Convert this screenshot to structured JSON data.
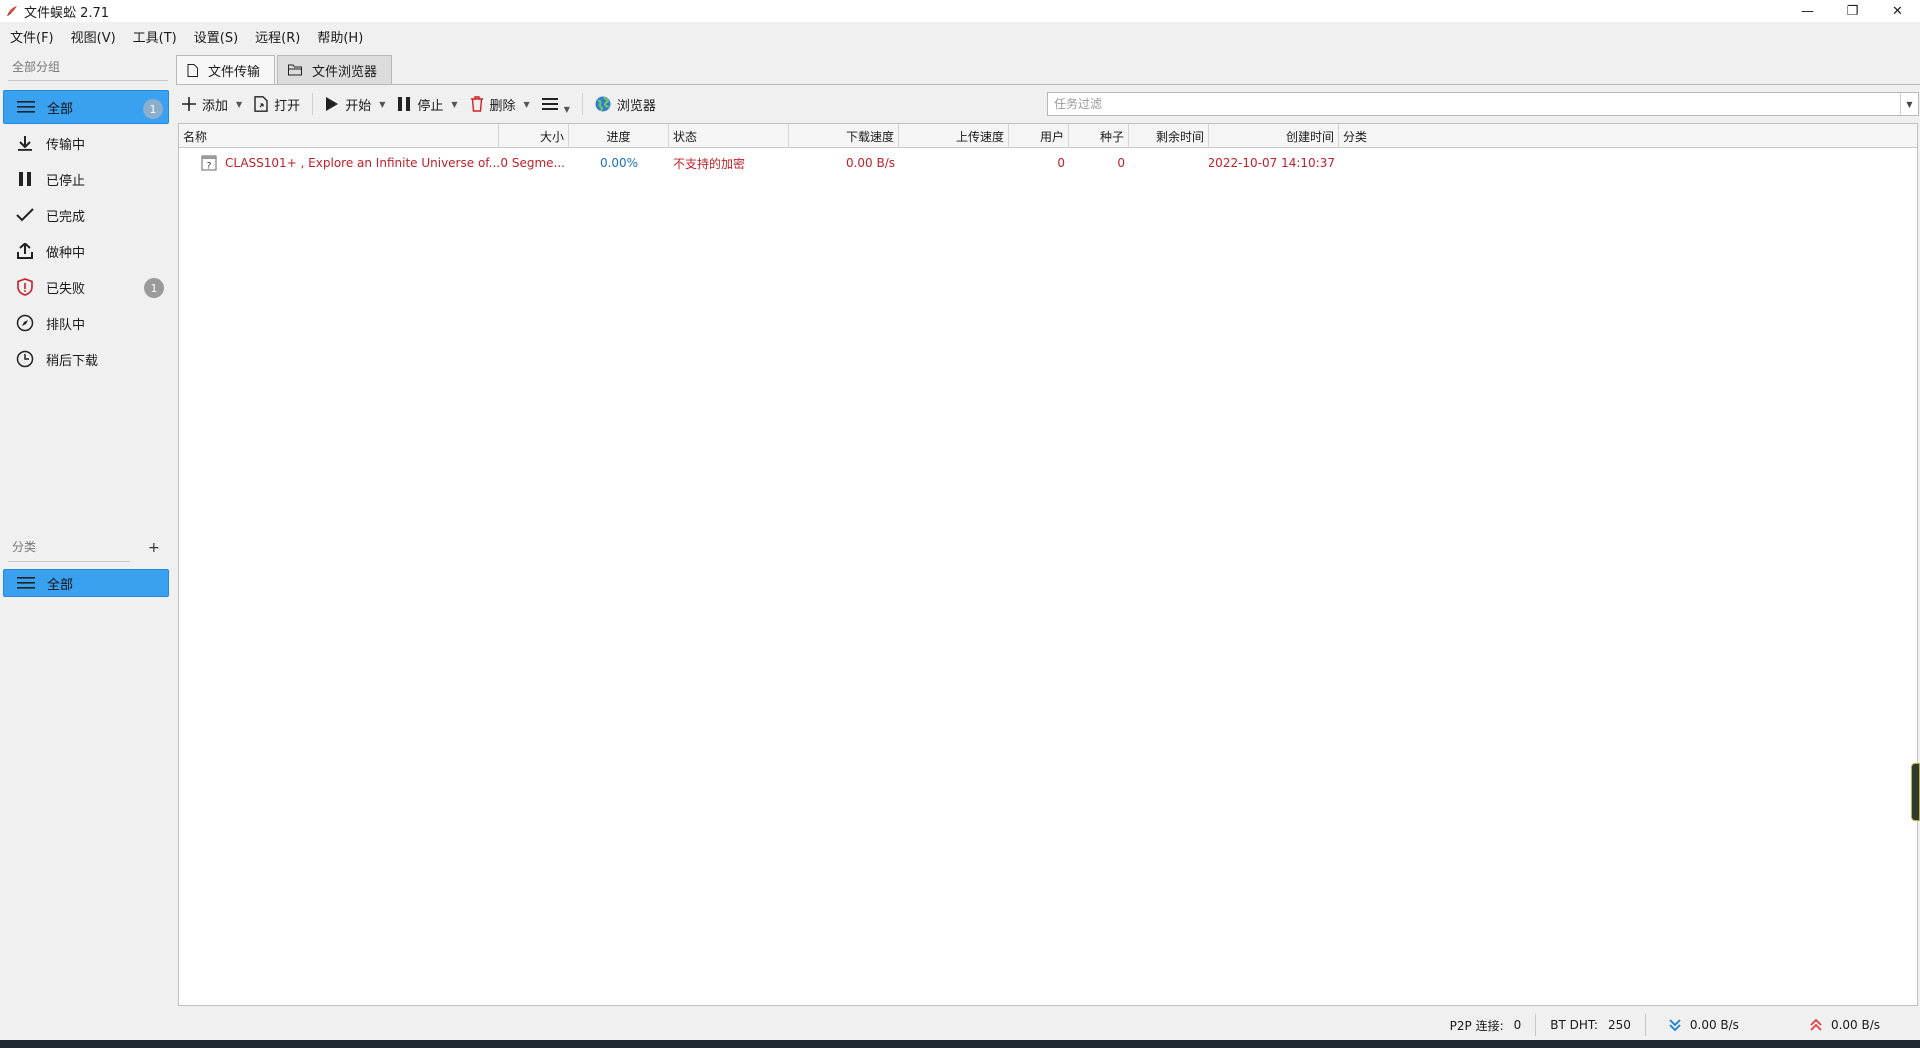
{
  "window": {
    "title": "文件蜈蚣 2.71",
    "controls": {
      "minimize": "—",
      "restore": "❐",
      "close": "✕"
    }
  },
  "menubar": {
    "items": [
      "文件(F)",
      "视图(V)",
      "工具(T)",
      "设置(S)",
      "远程(R)",
      "帮助(H)"
    ]
  },
  "sidebar": {
    "groups_label": "全部分组",
    "items": [
      {
        "label": "全部",
        "icon": "list-icon",
        "count": "1",
        "active": true
      },
      {
        "label": "传输中",
        "icon": "download-icon"
      },
      {
        "label": "已停止",
        "icon": "pause-icon"
      },
      {
        "label": "已完成",
        "icon": "check-icon"
      },
      {
        "label": "做种中",
        "icon": "upload-icon"
      },
      {
        "label": "已失败",
        "icon": "shield-alert-icon",
        "count": "1"
      },
      {
        "label": "排队中",
        "icon": "compass-icon"
      },
      {
        "label": "稍后下载",
        "icon": "clock-icon"
      }
    ],
    "categories_label": "分类",
    "add_label": "+",
    "categories": [
      {
        "label": "全部",
        "icon": "list-icon",
        "active": true
      }
    ]
  },
  "tabs": [
    {
      "label": "文件传输",
      "icon": "file-icon",
      "active": true
    },
    {
      "label": "文件浏览器",
      "icon": "folder-icon",
      "active": false
    }
  ],
  "toolbar": {
    "add": "添加",
    "open": "打开",
    "start": "开始",
    "stop": "停止",
    "delete": "删除",
    "browser": "浏览器"
  },
  "filter": {
    "placeholder": "任务过滤",
    "value": ""
  },
  "table": {
    "columns": [
      "名称",
      "大小",
      "进度",
      "状态",
      "下载速度",
      "上传速度",
      "用户",
      "种子",
      "剩余时间",
      "创建时间",
      "分类"
    ],
    "rows": [
      {
        "name": "CLASS101+ , Explore an Infinite Universe of...",
        "size": "0 Segme...",
        "progress": "0.00%",
        "status": "不支持的加密",
        "download_speed": "0.00 B/s",
        "upload_speed": "",
        "peers": "0",
        "seeds": "0",
        "remaining": "",
        "created": "2022-10-07 14:10:37",
        "category": ""
      }
    ]
  },
  "statusbar": {
    "p2p_label": "P2P 连接:",
    "p2p_value": "0",
    "dht_label": "BT DHT:",
    "dht_value": "250",
    "down_speed": "0.00 B/s",
    "up_speed": "0.00 B/s"
  },
  "colors": {
    "accent": "#3aa0f0",
    "error_text": "#c0202a",
    "progress_text": "#1a6fc0",
    "down_icon": "#1a80d0",
    "up_icon": "#e04040"
  }
}
